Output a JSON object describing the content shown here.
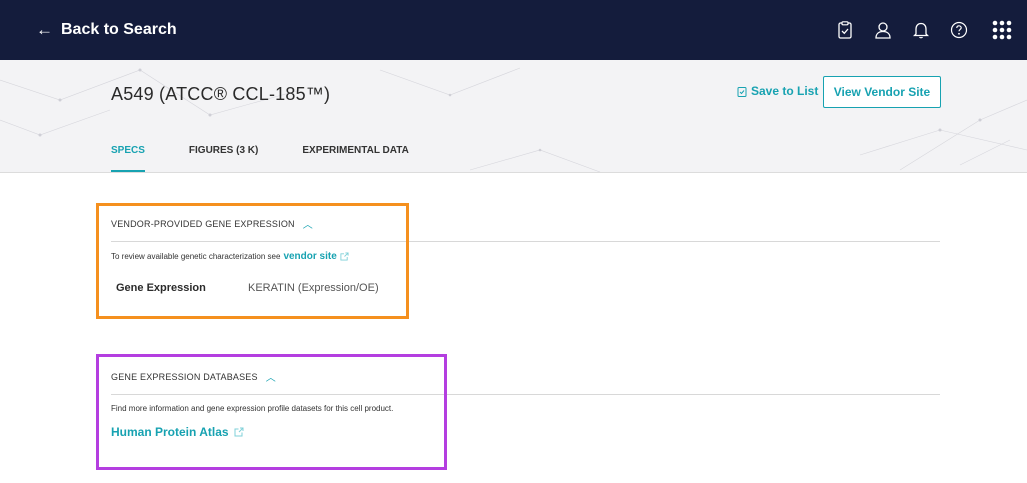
{
  "topbar": {
    "back_label": "Back to Search",
    "icons": [
      "list-check-icon",
      "user-icon",
      "bell-icon",
      "help-icon",
      "apps-grid-icon"
    ]
  },
  "header": {
    "title": "A549 (ATCC® CCL-185™)",
    "save_label": "Save to List",
    "vendor_button": "View Vendor Site",
    "tabs": [
      {
        "label": "SPECS",
        "active": true
      },
      {
        "label": "FIGURES (3 K)",
        "active": false
      },
      {
        "label": "EXPERIMENTAL DATA",
        "active": false
      }
    ]
  },
  "vendor_section": {
    "heading": "VENDOR-PROVIDED GENE EXPRESSION",
    "sub_text": "To review available genetic characterization see",
    "link_text": "vendor site",
    "key": "Gene Expression",
    "value": "KERATIN (Expression/OE)"
  },
  "db_section": {
    "heading": "GENE EXPRESSION DATABASES",
    "sub_text": "Find more information and gene expression profile datasets for this cell product.",
    "link_text": "Human Protein Atlas"
  },
  "colors": {
    "topbar": "#141c3c",
    "accent": "#17a2b1",
    "highlight_orange": "#f5901e",
    "highlight_purple": "#b43ee0"
  }
}
